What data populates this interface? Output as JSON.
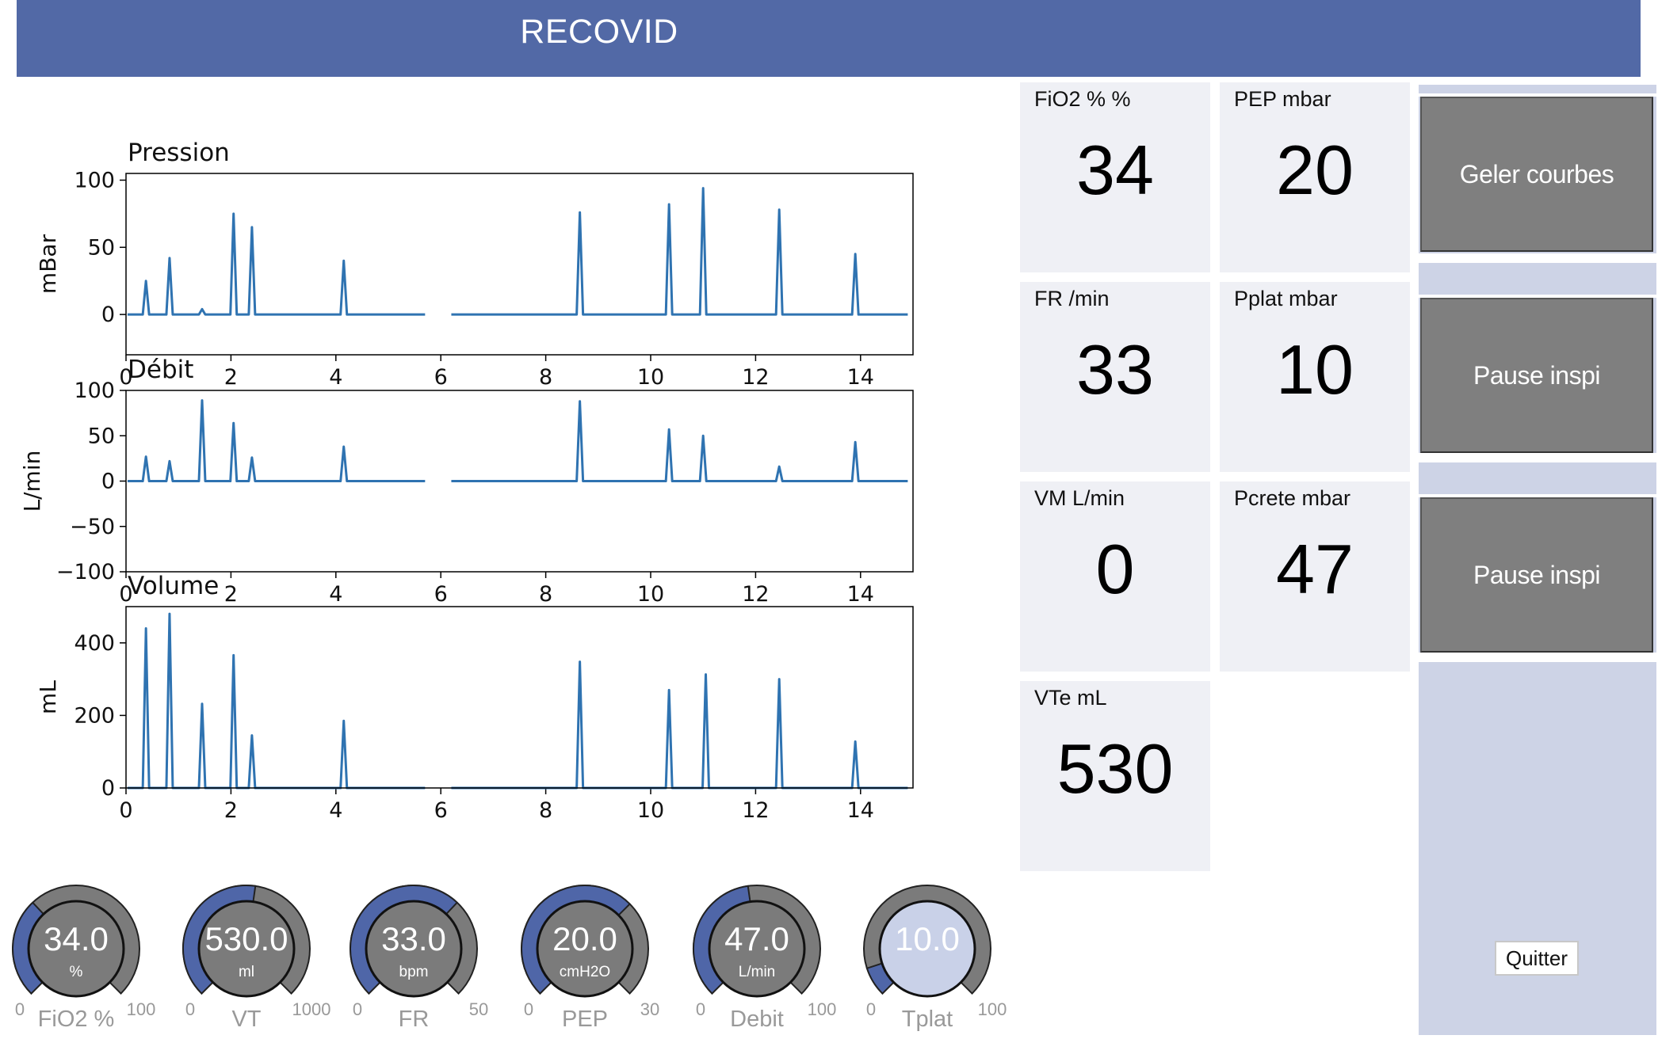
{
  "app": {
    "title": "RECOVID"
  },
  "colors": {
    "header": "#5269a6",
    "accent": "#4f66a8",
    "gauge_track": "#7b7b7b",
    "gauge_highlight": "#c9d1e8",
    "tile_bg": "#eff0f5",
    "side_panel": "#cdd3e6",
    "button": "#7f7f7f",
    "trace": "#2f73b1"
  },
  "chart_data": [
    {
      "type": "line",
      "title": "Pression",
      "ylabel": "mBar",
      "xlabel": "",
      "xlim": [
        0,
        15
      ],
      "ylim": [
        -30,
        105
      ],
      "xticks": [
        0,
        2,
        4,
        6,
        8,
        10,
        12,
        14
      ],
      "yticks": [
        0,
        50,
        100
      ],
      "grid": false,
      "gap": [
        5.7,
        6.2
      ],
      "peaks": [
        [
          0.38,
          25
        ],
        [
          0.83,
          42
        ],
        [
          1.45,
          4
        ],
        [
          2.05,
          75
        ],
        [
          2.4,
          65
        ],
        [
          4.15,
          40
        ],
        [
          8.65,
          76
        ],
        [
          10.35,
          82
        ],
        [
          11.0,
          94
        ],
        [
          12.45,
          78
        ],
        [
          13.9,
          45
        ]
      ]
    },
    {
      "type": "line",
      "title": "Débit",
      "ylabel": "L/min",
      "xlabel": "",
      "xlim": [
        0,
        15
      ],
      "ylim": [
        -100,
        100
      ],
      "xticks": [
        0,
        2,
        4,
        6,
        8,
        10,
        12,
        14
      ],
      "yticks": [
        -100,
        -50,
        0,
        50,
        100
      ],
      "tick_labels_y": [
        "−100",
        "−50",
        "0",
        "50",
        "100"
      ],
      "grid": false,
      "gap": [
        5.7,
        6.2
      ],
      "peaks": [
        [
          0.38,
          27
        ],
        [
          0.83,
          22
        ],
        [
          1.45,
          89
        ],
        [
          2.05,
          64
        ],
        [
          2.4,
          26
        ],
        [
          4.15,
          38
        ],
        [
          8.65,
          88
        ],
        [
          10.35,
          57
        ],
        [
          11.0,
          50
        ],
        [
          12.45,
          16
        ],
        [
          13.9,
          43
        ]
      ]
    },
    {
      "type": "line",
      "title": "Volume",
      "ylabel": "mL",
      "xlabel": "",
      "xlim": [
        0,
        15
      ],
      "ylim": [
        0,
        500
      ],
      "xticks": [
        0,
        2,
        4,
        6,
        8,
        10,
        12,
        14
      ],
      "yticks": [
        0,
        200,
        400
      ],
      "grid": false,
      "gap": [
        5.7,
        6.2
      ],
      "peaks": [
        [
          0.38,
          440
        ],
        [
          0.83,
          480
        ],
        [
          1.45,
          232
        ],
        [
          2.05,
          366
        ],
        [
          2.4,
          145
        ],
        [
          4.15,
          185
        ],
        [
          8.65,
          348
        ],
        [
          10.35,
          270
        ],
        [
          11.05,
          313
        ],
        [
          12.45,
          300
        ],
        [
          13.9,
          128
        ]
      ]
    }
  ],
  "tiles": [
    {
      "label": "FiO2 % %",
      "value": "34"
    },
    {
      "label": "PEP mbar",
      "value": "20"
    },
    {
      "label": "FR /min",
      "value": "33"
    },
    {
      "label": "Pplat mbar",
      "value": "10"
    },
    {
      "label": "VM L/min",
      "value": "0"
    },
    {
      "label": "Pcrete mbar",
      "value": "47"
    },
    {
      "label": "VTe mL",
      "value": "530"
    }
  ],
  "buttons": {
    "freeze": "Geler courbes",
    "pause1": "Pause inspi",
    "pause2": "Pause inspi",
    "quit": "Quitter"
  },
  "gauges": [
    {
      "name": "FiO2 %",
      "value": "34.0",
      "unit": "%",
      "min": "0",
      "max": "100",
      "fraction": 0.34,
      "highlight": false
    },
    {
      "name": "VT",
      "value": "530.0",
      "unit": "ml",
      "min": "0",
      "max": "1000",
      "fraction": 0.53,
      "highlight": false
    },
    {
      "name": "FR",
      "value": "33.0",
      "unit": "bpm",
      "min": "0",
      "max": "50",
      "fraction": 0.66,
      "highlight": false
    },
    {
      "name": "PEP",
      "value": "20.0",
      "unit": "cmH2O",
      "min": "0",
      "max": "30",
      "fraction": 0.667,
      "highlight": false
    },
    {
      "name": "Debit",
      "value": "47.0",
      "unit": "L/min",
      "min": "0",
      "max": "100",
      "fraction": 0.47,
      "highlight": false
    },
    {
      "name": "Tplat",
      "value": "10.0",
      "unit": "",
      "min": "0",
      "max": "100",
      "fraction": 0.1,
      "highlight": true
    }
  ]
}
